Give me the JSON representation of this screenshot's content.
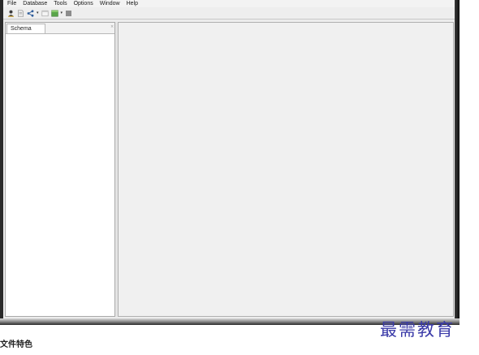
{
  "menubar": {
    "items": [
      "File",
      "Database",
      "Tools",
      "Options",
      "Window",
      "Help"
    ]
  },
  "toolbar": {
    "buttons": [
      {
        "icon": "user-icon"
      },
      {
        "icon": "document-icon"
      },
      {
        "icon": "connect-icon",
        "dropdown": true
      },
      {
        "icon": "sql-editor-icon"
      },
      {
        "icon": "table-icon",
        "dropdown": true
      },
      {
        "icon": "stop-icon"
      }
    ],
    "dropdown_glyph": "▾"
  },
  "left_panel": {
    "tab_label": "Schema",
    "tab_close_glyph": "×"
  },
  "footer": {
    "caption": "文件特色",
    "watermark": "最需教育"
  },
  "colors": {
    "frame": "#1c1c1c",
    "app_bg": "#ececec",
    "editor_bg": "#f0f0f0",
    "watermark": "#3a3aa8"
  }
}
